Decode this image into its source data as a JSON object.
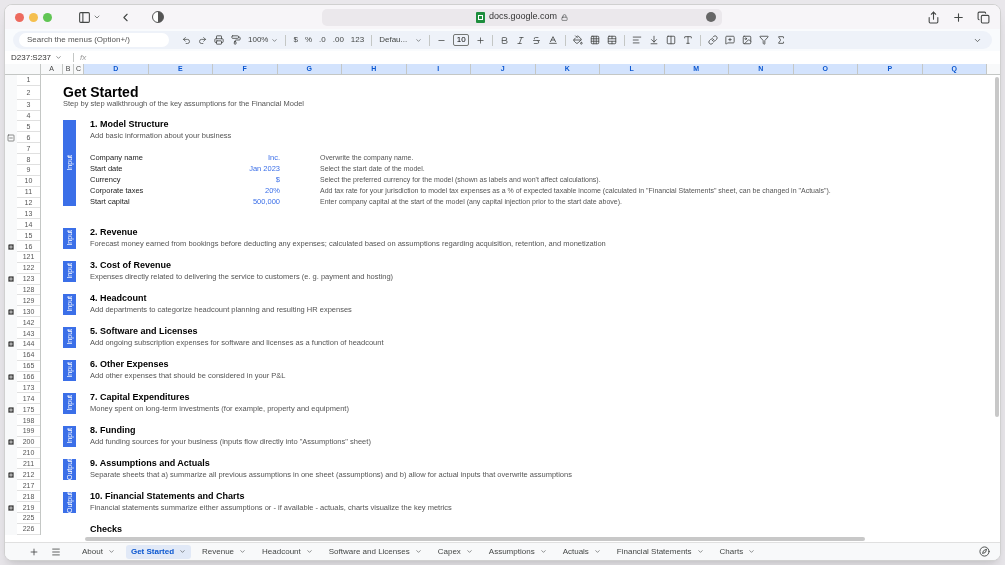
{
  "browser": {
    "url": "docs.google.com"
  },
  "toolbar": {
    "search_placeholder": "Search the menus (Option+/)",
    "zoom": "100%",
    "currency": "$",
    "percent": "%",
    "decimal_less": ".0",
    "decimal_more": ".00",
    "number_format": "123",
    "font": "Defau...",
    "font_size": "10"
  },
  "formula_bar": {
    "name_box": "D237:S237",
    "fx": "fx"
  },
  "columns": [
    {
      "label": "A",
      "selected": false
    },
    {
      "label": "B",
      "selected": false
    },
    {
      "label": "C",
      "selected": false
    },
    {
      "label": "D",
      "selected": true
    },
    {
      "label": "E",
      "selected": true
    },
    {
      "label": "F",
      "selected": true
    },
    {
      "label": "G",
      "selected": true
    },
    {
      "label": "H",
      "selected": true
    },
    {
      "label": "I",
      "selected": true
    },
    {
      "label": "J",
      "selected": true
    },
    {
      "label": "K",
      "selected": true
    },
    {
      "label": "L",
      "selected": true
    },
    {
      "label": "M",
      "selected": true
    },
    {
      "label": "N",
      "selected": true
    },
    {
      "label": "O",
      "selected": true
    },
    {
      "label": "P",
      "selected": true
    },
    {
      "label": "Q",
      "selected": true
    }
  ],
  "rows": [
    {
      "label": "1"
    },
    {
      "label": "2"
    },
    {
      "label": "3"
    },
    {
      "label": "4"
    },
    {
      "label": "5"
    },
    {
      "label": "6",
      "collapsed": false
    },
    {
      "label": "7"
    },
    {
      "label": "8"
    },
    {
      "label": "9"
    },
    {
      "label": "10"
    },
    {
      "label": "11"
    },
    {
      "label": "12"
    },
    {
      "label": "13"
    },
    {
      "label": "14"
    },
    {
      "label": "15"
    },
    {
      "label": "16",
      "collapsed": true
    },
    {
      "label": "121"
    },
    {
      "label": "122"
    },
    {
      "label": "123",
      "collapsed": true
    },
    {
      "label": "128"
    },
    {
      "label": "129"
    },
    {
      "label": "130",
      "collapsed": true
    },
    {
      "label": "142"
    },
    {
      "label": "143"
    },
    {
      "label": "144",
      "collapsed": true
    },
    {
      "label": "164"
    },
    {
      "label": "165"
    },
    {
      "label": "166",
      "collapsed": true
    },
    {
      "label": "173"
    },
    {
      "label": "174"
    },
    {
      "label": "175",
      "collapsed": true
    },
    {
      "label": "198"
    },
    {
      "label": "199"
    },
    {
      "label": "200",
      "collapsed": true
    },
    {
      "label": "210"
    },
    {
      "label": "211"
    },
    {
      "label": "212",
      "collapsed": true
    },
    {
      "label": "217"
    },
    {
      "label": "218"
    },
    {
      "label": "219",
      "collapsed": true
    },
    {
      "label": "225"
    },
    {
      "label": "226"
    }
  ],
  "sheet": {
    "title": "Get Started",
    "subtitle": "Step by step walkthrough of the key assumptions for the Financial Model",
    "sections": [
      {
        "badge": "Input",
        "title": "1. Model Structure",
        "description": "Add basic information about your business",
        "fields": [
          {
            "label": "Company name",
            "value": "Inc.",
            "note": "Overwrite the company name."
          },
          {
            "label": "Start date",
            "value": "Jan 2023",
            "note": "Select the start date of the model."
          },
          {
            "label": "Currency",
            "value": "$",
            "note": "Select the preferred currency for the model (shown as labels and won't affect calculations)."
          },
          {
            "label": "Corporate taxes",
            "value": "20%",
            "note": "Add tax rate for your jurisdiction to model tax expenses as a % of expected taxable income (calculated in \"Financial Statements\" sheet, can be changed in \"Actuals\")."
          },
          {
            "label": "Start capital",
            "value": "500,000",
            "note": "Enter company capital at the start of the model (any capital injection prior to the start date above)."
          }
        ]
      },
      {
        "badge": "Input",
        "title": "2. Revenue",
        "description": "Forecast money earned from bookings before deducting any expenses; calculated based on assumptions regarding acquisition, retention, and monetization"
      },
      {
        "badge": "Input",
        "title": "3. Cost of Revenue",
        "description": "Expenses directly related to delivering the service to customers (e. g. payment and hosting)"
      },
      {
        "badge": "Input",
        "title": "4. Headcount",
        "description": "Add departments to categorize headcount planning and resulting HR expenses"
      },
      {
        "badge": "Input",
        "title": "5. Software and Licenses",
        "description": "Add ongoing subscription expenses for software and licenses as a function of headcount"
      },
      {
        "badge": "Input",
        "title": "6. Other Expenses",
        "description": "Add other expenses that should be considered in your P&L"
      },
      {
        "badge": "Input",
        "title": "7. Capital Expenditures",
        "description": "Money spent on long-term investments (for example, property and equipment)"
      },
      {
        "badge": "Input",
        "title": "8. Funding",
        "description": "Add funding sources for your business (inputs flow directly into \"Assumptions\" sheet)"
      },
      {
        "badge": "Output",
        "title": "9. Assumptions and Actuals",
        "description": "Separate sheets that a) summarize all previous assumptions in one sheet (assumptions) and b) allow for actual inputs that overwrite assumptions"
      },
      {
        "badge": "Output",
        "title": "10. Financial Statements and Charts",
        "description": "Financial statements summarize either assumptions or - if available - actuals, charts visualize the key metrics"
      }
    ],
    "checks_title": "Checks"
  },
  "tabs": [
    {
      "label": "About",
      "selected": false
    },
    {
      "label": "Get Started",
      "selected": true
    },
    {
      "label": "Revenue",
      "selected": false
    },
    {
      "label": "Headcount",
      "selected": false
    },
    {
      "label": "Software and Licenses",
      "selected": false
    },
    {
      "label": "Capex",
      "selected": false
    },
    {
      "label": "Assumptions",
      "selected": false
    },
    {
      "label": "Actuals",
      "selected": false
    },
    {
      "label": "Financial Statements",
      "selected": false
    },
    {
      "label": "Charts",
      "selected": false
    }
  ]
}
